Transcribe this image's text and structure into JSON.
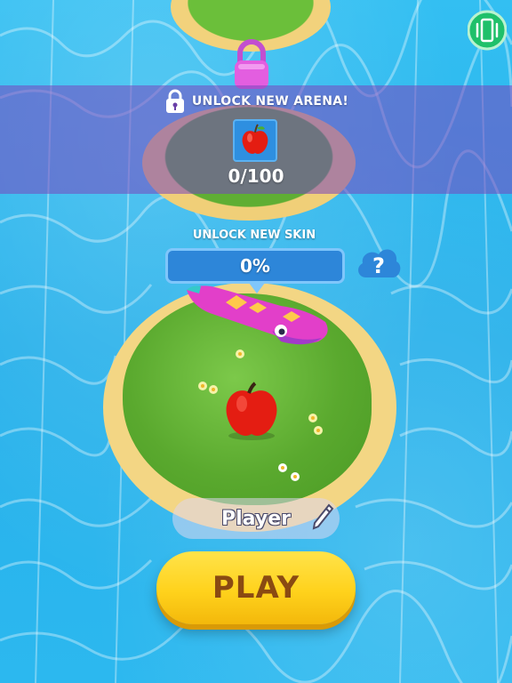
{
  "arena": {
    "title": "UNLOCK NEW ARENA!",
    "progress": "0/100",
    "tile_icon": "apple-icon"
  },
  "skin": {
    "title": "UNLOCK NEW SKIN",
    "percent_label": "0%",
    "progress": 0
  },
  "player": {
    "name": "Player"
  },
  "play_button": {
    "label": "PLAY"
  },
  "icons": {
    "lock": "lock-icon",
    "help": "question-mark-icon",
    "edit": "pencil-icon",
    "vibration": "phone-vibration-icon"
  },
  "colors": {
    "water": "#2fb6ee",
    "grass": "#62b335",
    "sand": "#f3d684",
    "arena_band": "#7846be",
    "play_button": "#ffd21c",
    "play_text": "#8a4a12",
    "skin_bar": "#2d86d9",
    "apple": "#e41d12",
    "snake": "#e23fc9",
    "vibration_button": "#1fc06a"
  }
}
